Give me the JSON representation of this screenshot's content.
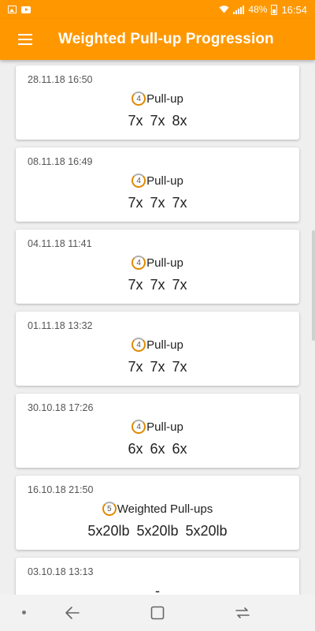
{
  "status_bar": {
    "battery": "48%",
    "time": "16:54"
  },
  "app_bar": {
    "title": "Weighted Pull-up Progression"
  },
  "workouts": [
    {
      "date": "28.11.18 16:50",
      "level": "4",
      "exercise": "Pull-up",
      "sets": "7x 7x 8x"
    },
    {
      "date": "08.11.18 16:49",
      "level": "4",
      "exercise": "Pull-up",
      "sets": "7x 7x 7x"
    },
    {
      "date": "04.11.18 11:41",
      "level": "4",
      "exercise": "Pull-up",
      "sets": "7x 7x 7x"
    },
    {
      "date": "01.11.18 13:32",
      "level": "4",
      "exercise": "Pull-up",
      "sets": "7x 7x 7x"
    },
    {
      "date": "30.10.18 17:26",
      "level": "4",
      "exercise": "Pull-up",
      "sets": "6x 6x 6x"
    },
    {
      "date": "16.10.18 21:50",
      "level": "5",
      "exercise": "Weighted Pull-ups",
      "sets": "5x20lb 5x20lb 5x20lb"
    },
    {
      "date": "03.10.18 13:13",
      "level": "",
      "exercise": "",
      "sets": "-"
    }
  ],
  "colors": {
    "primary": "#ff9800",
    "background": "#efefef",
    "level_ring": "#e08a00"
  },
  "icons": {
    "menu": "hamburger-menu-icon",
    "level": "level-badge-icon",
    "nav_back": "back-arrow-icon",
    "nav_home": "home-square-icon",
    "nav_recents": "recents-icon"
  }
}
